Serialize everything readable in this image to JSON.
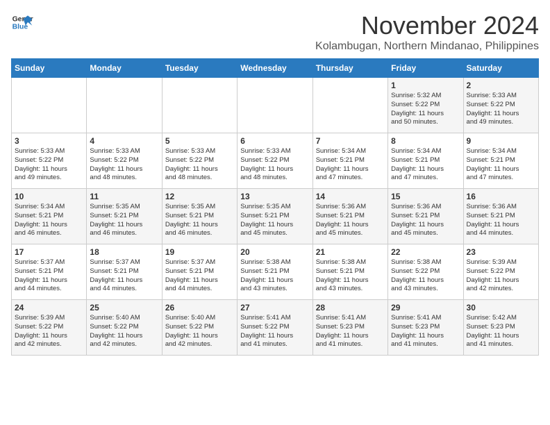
{
  "header": {
    "logo_line1": "General",
    "logo_line2": "Blue",
    "month": "November 2024",
    "location": "Kolambugan, Northern Mindanao, Philippines"
  },
  "weekdays": [
    "Sunday",
    "Monday",
    "Tuesday",
    "Wednesday",
    "Thursday",
    "Friday",
    "Saturday"
  ],
  "weeks": [
    [
      {
        "day": "",
        "info": ""
      },
      {
        "day": "",
        "info": ""
      },
      {
        "day": "",
        "info": ""
      },
      {
        "day": "",
        "info": ""
      },
      {
        "day": "",
        "info": ""
      },
      {
        "day": "1",
        "info": "Sunrise: 5:32 AM\nSunset: 5:22 PM\nDaylight: 11 hours\nand 50 minutes."
      },
      {
        "day": "2",
        "info": "Sunrise: 5:33 AM\nSunset: 5:22 PM\nDaylight: 11 hours\nand 49 minutes."
      }
    ],
    [
      {
        "day": "3",
        "info": "Sunrise: 5:33 AM\nSunset: 5:22 PM\nDaylight: 11 hours\nand 49 minutes."
      },
      {
        "day": "4",
        "info": "Sunrise: 5:33 AM\nSunset: 5:22 PM\nDaylight: 11 hours\nand 48 minutes."
      },
      {
        "day": "5",
        "info": "Sunrise: 5:33 AM\nSunset: 5:22 PM\nDaylight: 11 hours\nand 48 minutes."
      },
      {
        "day": "6",
        "info": "Sunrise: 5:33 AM\nSunset: 5:22 PM\nDaylight: 11 hours\nand 48 minutes."
      },
      {
        "day": "7",
        "info": "Sunrise: 5:34 AM\nSunset: 5:21 PM\nDaylight: 11 hours\nand 47 minutes."
      },
      {
        "day": "8",
        "info": "Sunrise: 5:34 AM\nSunset: 5:21 PM\nDaylight: 11 hours\nand 47 minutes."
      },
      {
        "day": "9",
        "info": "Sunrise: 5:34 AM\nSunset: 5:21 PM\nDaylight: 11 hours\nand 47 minutes."
      }
    ],
    [
      {
        "day": "10",
        "info": "Sunrise: 5:34 AM\nSunset: 5:21 PM\nDaylight: 11 hours\nand 46 minutes."
      },
      {
        "day": "11",
        "info": "Sunrise: 5:35 AM\nSunset: 5:21 PM\nDaylight: 11 hours\nand 46 minutes."
      },
      {
        "day": "12",
        "info": "Sunrise: 5:35 AM\nSunset: 5:21 PM\nDaylight: 11 hours\nand 46 minutes."
      },
      {
        "day": "13",
        "info": "Sunrise: 5:35 AM\nSunset: 5:21 PM\nDaylight: 11 hours\nand 45 minutes."
      },
      {
        "day": "14",
        "info": "Sunrise: 5:36 AM\nSunset: 5:21 PM\nDaylight: 11 hours\nand 45 minutes."
      },
      {
        "day": "15",
        "info": "Sunrise: 5:36 AM\nSunset: 5:21 PM\nDaylight: 11 hours\nand 45 minutes."
      },
      {
        "day": "16",
        "info": "Sunrise: 5:36 AM\nSunset: 5:21 PM\nDaylight: 11 hours\nand 44 minutes."
      }
    ],
    [
      {
        "day": "17",
        "info": "Sunrise: 5:37 AM\nSunset: 5:21 PM\nDaylight: 11 hours\nand 44 minutes."
      },
      {
        "day": "18",
        "info": "Sunrise: 5:37 AM\nSunset: 5:21 PM\nDaylight: 11 hours\nand 44 minutes."
      },
      {
        "day": "19",
        "info": "Sunrise: 5:37 AM\nSunset: 5:21 PM\nDaylight: 11 hours\nand 44 minutes."
      },
      {
        "day": "20",
        "info": "Sunrise: 5:38 AM\nSunset: 5:21 PM\nDaylight: 11 hours\nand 43 minutes."
      },
      {
        "day": "21",
        "info": "Sunrise: 5:38 AM\nSunset: 5:21 PM\nDaylight: 11 hours\nand 43 minutes."
      },
      {
        "day": "22",
        "info": "Sunrise: 5:38 AM\nSunset: 5:22 PM\nDaylight: 11 hours\nand 43 minutes."
      },
      {
        "day": "23",
        "info": "Sunrise: 5:39 AM\nSunset: 5:22 PM\nDaylight: 11 hours\nand 42 minutes."
      }
    ],
    [
      {
        "day": "24",
        "info": "Sunrise: 5:39 AM\nSunset: 5:22 PM\nDaylight: 11 hours\nand 42 minutes."
      },
      {
        "day": "25",
        "info": "Sunrise: 5:40 AM\nSunset: 5:22 PM\nDaylight: 11 hours\nand 42 minutes."
      },
      {
        "day": "26",
        "info": "Sunrise: 5:40 AM\nSunset: 5:22 PM\nDaylight: 11 hours\nand 42 minutes."
      },
      {
        "day": "27",
        "info": "Sunrise: 5:41 AM\nSunset: 5:22 PM\nDaylight: 11 hours\nand 41 minutes."
      },
      {
        "day": "28",
        "info": "Sunrise: 5:41 AM\nSunset: 5:23 PM\nDaylight: 11 hours\nand 41 minutes."
      },
      {
        "day": "29",
        "info": "Sunrise: 5:41 AM\nSunset: 5:23 PM\nDaylight: 11 hours\nand 41 minutes."
      },
      {
        "day": "30",
        "info": "Sunrise: 5:42 AM\nSunset: 5:23 PM\nDaylight: 11 hours\nand 41 minutes."
      }
    ]
  ]
}
